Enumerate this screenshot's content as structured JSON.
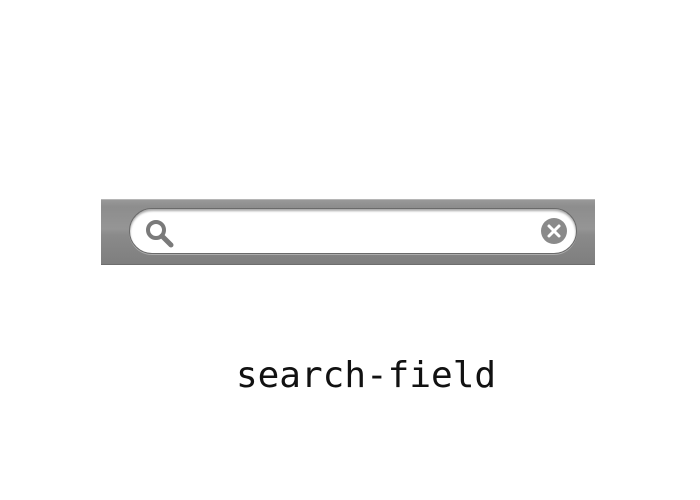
{
  "search": {
    "value": "",
    "placeholder": ""
  },
  "caption": "search-field",
  "icons": {
    "search": "magnifying-glass",
    "clear": "clear-x-circle"
  },
  "colors": {
    "bar": "#8f8f8f",
    "field": "#ffffff",
    "icon": "#7a7a7a"
  }
}
